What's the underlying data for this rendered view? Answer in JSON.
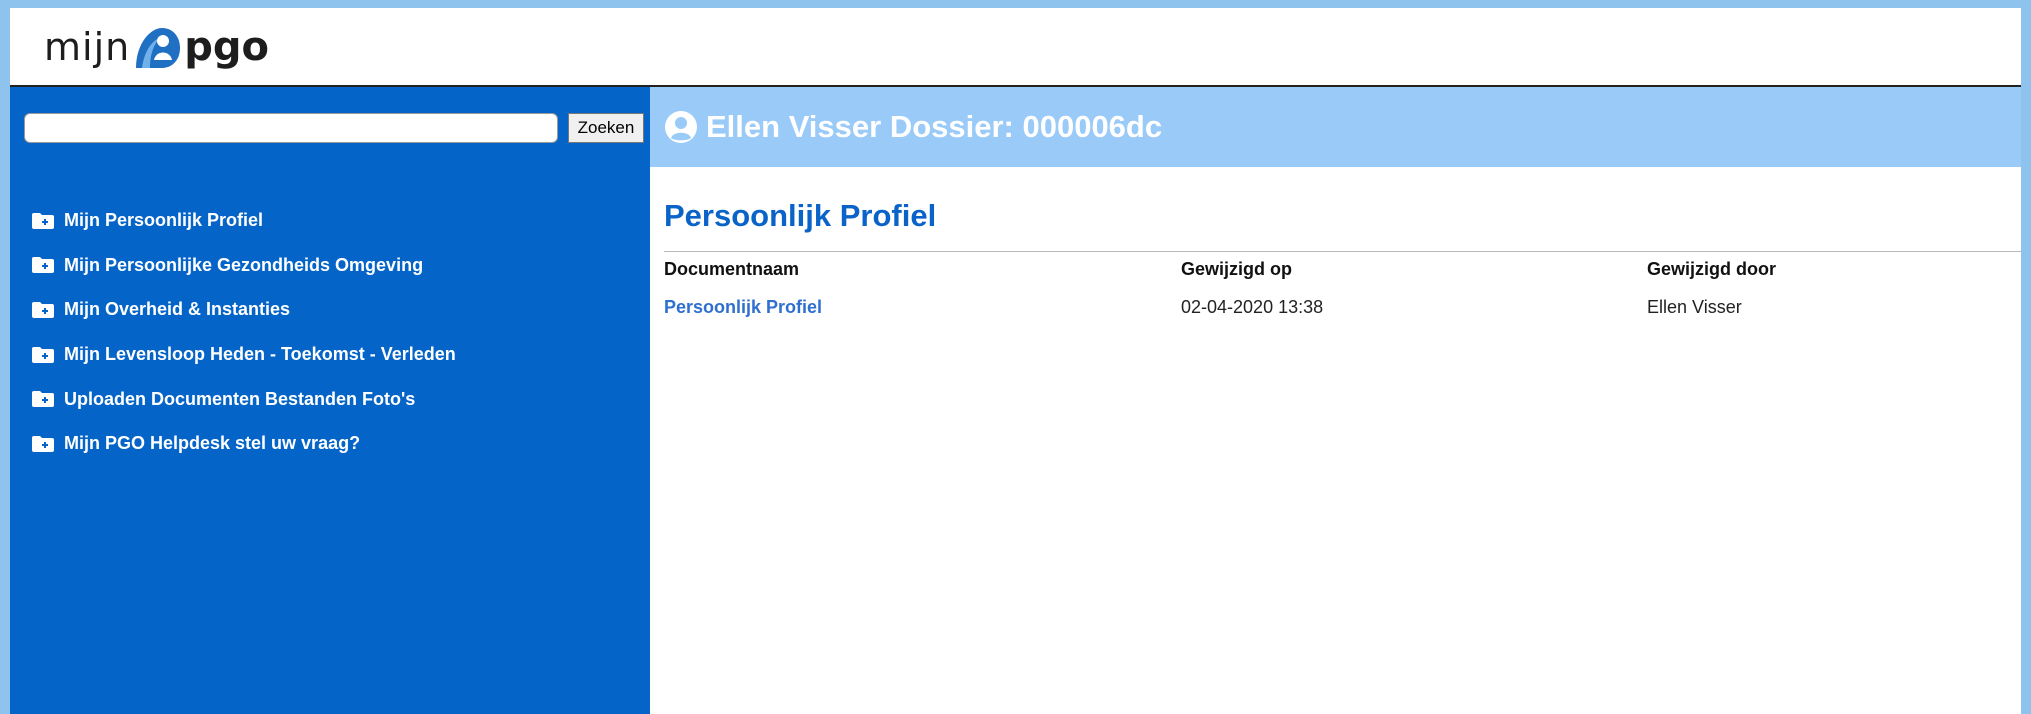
{
  "brand": {
    "logo_left": "mijn",
    "logo_right": "pgo"
  },
  "search": {
    "placeholder": "",
    "value": "",
    "button_label": "Zoeken"
  },
  "sidebar": {
    "items": [
      {
        "label": "Mijn Persoonlijk Profiel",
        "icon": "folder-plus-icon"
      },
      {
        "label": "Mijn Persoonlijke Gezondheids Omgeving",
        "icon": "folder-plus-icon"
      },
      {
        "label": "Mijn Overheid & Instanties",
        "icon": "folder-plus-icon"
      },
      {
        "label": "Mijn Levensloop Heden - Toekomst - Verleden",
        "icon": "folder-plus-icon"
      },
      {
        "label": "Uploaden Documenten Bestanden Foto's",
        "icon": "folder-plus-icon"
      },
      {
        "label": "Mijn PGO Helpdesk stel uw vraag?",
        "icon": "folder-plus-icon"
      }
    ]
  },
  "header": {
    "title": "Ellen Visser Dossier: 000006dc",
    "icon": "user-circle-icon"
  },
  "main": {
    "section_title": "Persoonlijk Profiel",
    "table": {
      "columns": [
        "Documentnaam",
        "Gewijzigd op",
        "Gewijzigd door"
      ],
      "rows": [
        [
          "Persoonlijk Profiel",
          "02-04-2020 13:38",
          "Ellen Visser"
        ]
      ]
    }
  },
  "colors": {
    "sidebar_bg": "#0564c8",
    "header_bg": "#9acaf8",
    "accent_title": "#0a63c9",
    "link": "#2f6fd0",
    "page_border": "#8dc3ec"
  }
}
